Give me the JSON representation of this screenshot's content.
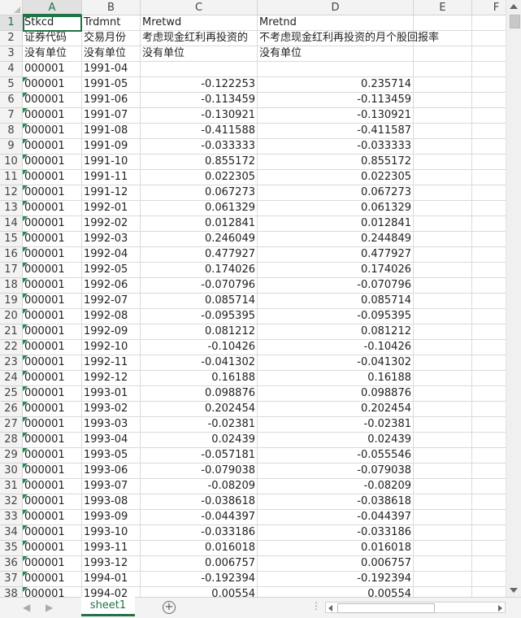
{
  "spreadsheet": {
    "columns": [
      "A",
      "B",
      "C",
      "D",
      "E",
      "F"
    ],
    "selected_cell": "A1",
    "rows": [
      {
        "n": "1",
        "a": "Stkcd",
        "b": "Trdmnt",
        "c": "Mretwd",
        "d": "Mretnd",
        "fa": false
      },
      {
        "n": "2",
        "a": "证券代码",
        "b": "交易月份",
        "c": "考虑现金红利再投资的",
        "d": "不考虑现金红利再投资的月个股回报率",
        "fa": false
      },
      {
        "n": "3",
        "a": "没有单位",
        "b": "没有单位",
        "c": "没有单位",
        "d": "没有单位",
        "fa": false
      },
      {
        "n": "4",
        "a": "000001",
        "b": "1991-04",
        "c": "",
        "d": "",
        "fa": false
      },
      {
        "n": "5",
        "a": "000001",
        "b": "1991-05",
        "c": "-0.122253",
        "d": "0.235714",
        "fa": true
      },
      {
        "n": "6",
        "a": "000001",
        "b": "1991-06",
        "c": "-0.113459",
        "d": "-0.113459",
        "fa": true
      },
      {
        "n": "7",
        "a": "000001",
        "b": "1991-07",
        "c": "-0.130921",
        "d": "-0.130921",
        "fa": true
      },
      {
        "n": "8",
        "a": "000001",
        "b": "1991-08",
        "c": "-0.411588",
        "d": "-0.411587",
        "fa": true
      },
      {
        "n": "9",
        "a": "000001",
        "b": "1991-09",
        "c": "-0.033333",
        "d": "-0.033333",
        "fa": true
      },
      {
        "n": "10",
        "a": "000001",
        "b": "1991-10",
        "c": "0.855172",
        "d": "0.855172",
        "fa": true
      },
      {
        "n": "11",
        "a": "000001",
        "b": "1991-11",
        "c": "0.022305",
        "d": "0.022305",
        "fa": true
      },
      {
        "n": "12",
        "a": "000001",
        "b": "1991-12",
        "c": "0.067273",
        "d": "0.067273",
        "fa": true
      },
      {
        "n": "13",
        "a": "000001",
        "b": "1992-01",
        "c": "0.061329",
        "d": "0.061329",
        "fa": true
      },
      {
        "n": "14",
        "a": "000001",
        "b": "1992-02",
        "c": "0.012841",
        "d": "0.012841",
        "fa": true
      },
      {
        "n": "15",
        "a": "000001",
        "b": "1992-03",
        "c": "0.246049",
        "d": "0.244849",
        "fa": true
      },
      {
        "n": "16",
        "a": "000001",
        "b": "1992-04",
        "c": "0.477927",
        "d": "0.477927",
        "fa": true
      },
      {
        "n": "17",
        "a": "000001",
        "b": "1992-05",
        "c": "0.174026",
        "d": "0.174026",
        "fa": true
      },
      {
        "n": "18",
        "a": "000001",
        "b": "1992-06",
        "c": "-0.070796",
        "d": "-0.070796",
        "fa": true
      },
      {
        "n": "19",
        "a": "000001",
        "b": "1992-07",
        "c": "0.085714",
        "d": "0.085714",
        "fa": true
      },
      {
        "n": "20",
        "a": "000001",
        "b": "1992-08",
        "c": "-0.095395",
        "d": "-0.095395",
        "fa": true
      },
      {
        "n": "21",
        "a": "000001",
        "b": "1992-09",
        "c": "0.081212",
        "d": "0.081212",
        "fa": true
      },
      {
        "n": "22",
        "a": "000001",
        "b": "1992-10",
        "c": "-0.10426",
        "d": "-0.10426",
        "fa": true
      },
      {
        "n": "23",
        "a": "000001",
        "b": "1992-11",
        "c": "-0.041302",
        "d": "-0.041302",
        "fa": true
      },
      {
        "n": "24",
        "a": "000001",
        "b": "1992-12",
        "c": "0.16188",
        "d": "0.16188",
        "fa": true
      },
      {
        "n": "25",
        "a": "000001",
        "b": "1993-01",
        "c": "0.098876",
        "d": "0.098876",
        "fa": true
      },
      {
        "n": "26",
        "a": "000001",
        "b": "1993-02",
        "c": "0.202454",
        "d": "0.202454",
        "fa": true
      },
      {
        "n": "27",
        "a": "000001",
        "b": "1993-03",
        "c": "-0.02381",
        "d": "-0.02381",
        "fa": true
      },
      {
        "n": "28",
        "a": "000001",
        "b": "1993-04",
        "c": "0.02439",
        "d": "0.02439",
        "fa": true
      },
      {
        "n": "29",
        "a": "000001",
        "b": "1993-05",
        "c": "-0.057181",
        "d": "-0.055546",
        "fa": true
      },
      {
        "n": "30",
        "a": "000001",
        "b": "1993-06",
        "c": "-0.079038",
        "d": "-0.079038",
        "fa": true
      },
      {
        "n": "31",
        "a": "000001",
        "b": "1993-07",
        "c": "-0.08209",
        "d": "-0.08209",
        "fa": true
      },
      {
        "n": "32",
        "a": "000001",
        "b": "1993-08",
        "c": "-0.038618",
        "d": "-0.038618",
        "fa": true
      },
      {
        "n": "33",
        "a": "000001",
        "b": "1993-09",
        "c": "-0.044397",
        "d": "-0.044397",
        "fa": true
      },
      {
        "n": "34",
        "a": "000001",
        "b": "1993-10",
        "c": "-0.033186",
        "d": "-0.033186",
        "fa": true
      },
      {
        "n": "35",
        "a": "000001",
        "b": "1993-11",
        "c": "0.016018",
        "d": "0.016018",
        "fa": true
      },
      {
        "n": "36",
        "a": "000001",
        "b": "1993-12",
        "c": "0.006757",
        "d": "0.006757",
        "fa": true
      },
      {
        "n": "37",
        "a": "000001",
        "b": "1994-01",
        "c": "-0.192394",
        "d": "-0.192394",
        "fa": true
      },
      {
        "n": "38",
        "a": "000001",
        "b": "1994-02",
        "c": "0.00554",
        "d": "0.00554",
        "fa": true
      }
    ]
  },
  "sheet_tabs": [
    "sheet1"
  ],
  "colors": {
    "accent": "#217346",
    "header_bg": "#f3f3f3",
    "gridline": "#dadada"
  },
  "icons": {
    "add_sheet": "plus-circle-icon",
    "prev": "nav-left-icon",
    "next": "nav-right-icon"
  }
}
